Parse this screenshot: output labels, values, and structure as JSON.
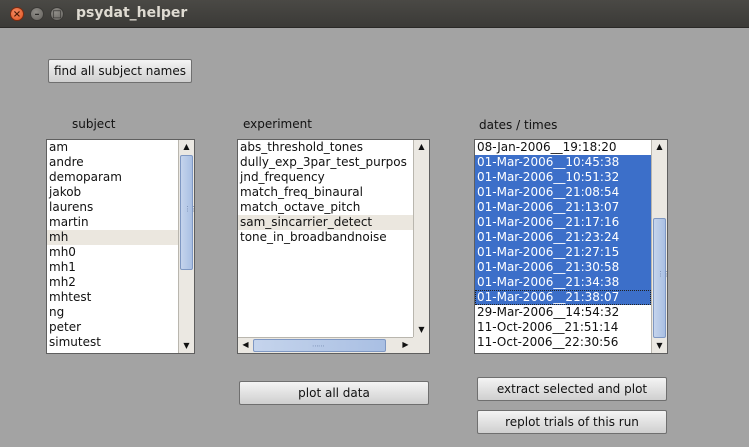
{
  "window": {
    "title": "psydat_helper"
  },
  "toolbar": {
    "find_label": "find all subject names"
  },
  "subject": {
    "label": "subject",
    "items": [
      "am",
      "andre",
      "demoparam",
      "jakob",
      "laurens",
      "martin",
      "mh",
      "mh0",
      "mh1",
      "mh2",
      "mhtest",
      "ng",
      "peter",
      "simutest"
    ],
    "highlighted": "mh"
  },
  "experiment": {
    "label": "experiment",
    "items": [
      "abs_threshold_tones",
      "dully_exp_3par_test_purpos",
      "jnd_frequency",
      "match_freq_binaural",
      "match_octave_pitch",
      "sam_sincarrier_detect",
      "tone_in_broadbandnoise"
    ],
    "highlighted": "sam_sincarrier_detect"
  },
  "dates": {
    "label": "dates / times",
    "items": [
      "08-Jan-2006__19:18:20",
      "01-Mar-2006__10:45:38",
      "01-Mar-2006__10:51:32",
      "01-Mar-2006__21:08:54",
      "01-Mar-2006__21:13:07",
      "01-Mar-2006__21:17:16",
      "01-Mar-2006__21:23:24",
      "01-Mar-2006__21:27:15",
      "01-Mar-2006__21:30:58",
      "01-Mar-2006__21:34:38",
      "01-Mar-2006__21:38:07",
      "29-Mar-2006__14:54:32",
      "11-Oct-2006__21:51:14",
      "11-Oct-2006__22:30:56"
    ],
    "selected_count": 10
  },
  "buttons": {
    "plot_all": "plot all data",
    "extract": "extract selected and plot",
    "replot": "replot trials of this run"
  },
  "colors": {
    "selection": "#3c6fc9",
    "background": "#a3a3a3",
    "highlight": "#ebe7df"
  }
}
